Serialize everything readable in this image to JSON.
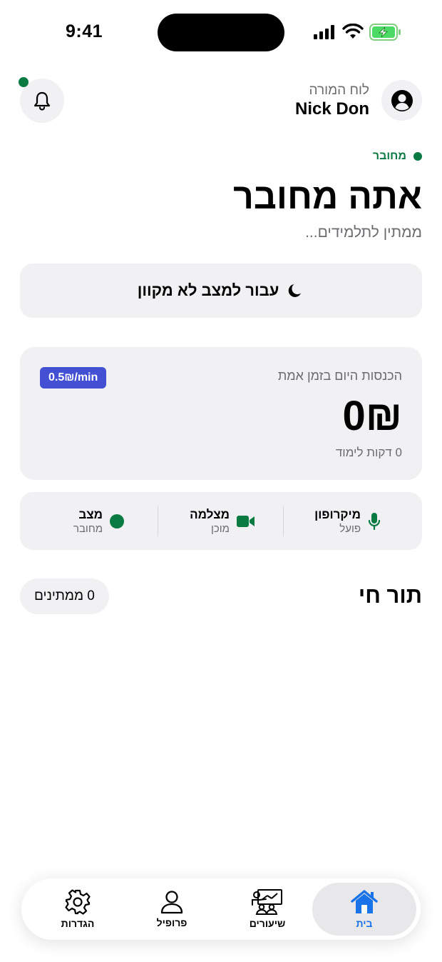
{
  "status_bar": {
    "time": "9:41"
  },
  "header": {
    "subtitle": "לוח המורה",
    "name": "Nick Don"
  },
  "status": {
    "connection_label": "מחובר",
    "title": "אתה מחובר",
    "waiting_text": "ממתין לתלמידים..."
  },
  "offline_button": {
    "label": "עבור למצב לא מקוון",
    "icon": "moon-icon"
  },
  "earnings": {
    "title": "הכנסות היום בזמן אמת",
    "rate": "0.5₪/min",
    "amount": "0₪",
    "minutes": "0 דקות לימוד"
  },
  "devices": [
    {
      "name": "מיקרופון",
      "state": "פועל",
      "icon": "microphone-icon"
    },
    {
      "name": "מצלמה",
      "state": "מוכן",
      "icon": "video-camera-icon"
    },
    {
      "name": "מצב",
      "state": "מחובר",
      "icon": "status-dot-icon"
    }
  ],
  "queue": {
    "title": "תור חי",
    "waiting_count": "0 ממתינים"
  },
  "nav": [
    {
      "label": "בית",
      "icon": "home-icon",
      "active": true
    },
    {
      "label": "שיעורים",
      "icon": "classroom-icon",
      "active": false
    },
    {
      "label": "פרופיל",
      "icon": "person-icon",
      "active": false
    },
    {
      "label": "הגדרות",
      "icon": "gear-icon",
      "active": false
    }
  ],
  "colors": {
    "accent_green": "#0a7a43",
    "badge_blue": "#4350d4",
    "nav_active_blue": "#1a73e8",
    "card_bg": "#f1f1f3"
  }
}
